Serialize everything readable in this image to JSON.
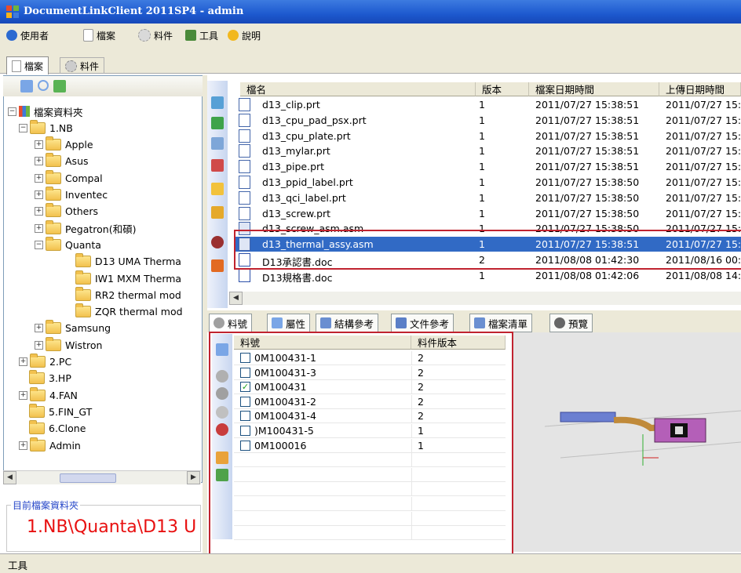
{
  "window": {
    "title": "DocumentLinkClient 2011SP4 - admin"
  },
  "menu": {
    "items": [
      {
        "label": "使用者",
        "icon": "user-icon",
        "color": "#2c6ad1"
      },
      {
        "label": "檔案",
        "icon": "file-icon",
        "color": "#f0f0f0"
      },
      {
        "label": "料件",
        "icon": "part-icon",
        "color": "#d9d9d9"
      },
      {
        "label": "工具",
        "icon": "tools-icon",
        "color": "#4a8a3a"
      },
      {
        "label": "說明",
        "icon": "help-icon",
        "color": "#f2b81e"
      }
    ]
  },
  "top_tabs": [
    {
      "label": "檔案",
      "icon": "file-icon"
    },
    {
      "label": "料件",
      "icon": "part-icon"
    }
  ],
  "tree": {
    "items": [
      {
        "label": "檔案資料夾",
        "level": 0,
        "expander": "−",
        "icon": "root-folder-icon"
      },
      {
        "label": "1.NB",
        "level": 1,
        "expander": "−",
        "icon": "folder-icon"
      },
      {
        "label": "Apple",
        "level": 2,
        "expander": "+",
        "icon": "folder-icon"
      },
      {
        "label": "Asus",
        "level": 2,
        "expander": "+",
        "icon": "folder-icon"
      },
      {
        "label": "Compal",
        "level": 2,
        "expander": "+",
        "icon": "folder-icon"
      },
      {
        "label": "Inventec",
        "level": 2,
        "expander": "+",
        "icon": "folder-icon"
      },
      {
        "label": "Others",
        "level": 2,
        "expander": "+",
        "icon": "folder-icon"
      },
      {
        "label": "Pegatron(和碩)",
        "level": 2,
        "expander": "+",
        "icon": "folder-icon"
      },
      {
        "label": "Quanta",
        "level": 2,
        "expander": "−",
        "icon": "folder-icon"
      },
      {
        "label": "D13 UMA Therma",
        "level": 3,
        "expander": "",
        "icon": "folder-icon"
      },
      {
        "label": "IW1 MXM Therma",
        "level": 3,
        "expander": "",
        "icon": "folder-icon"
      },
      {
        "label": "RR2 thermal mod",
        "level": 3,
        "expander": "",
        "icon": "folder-icon"
      },
      {
        "label": "ZQR thermal mod",
        "level": 3,
        "expander": "",
        "icon": "folder-icon"
      },
      {
        "label": "Samsung",
        "level": 2,
        "expander": "+",
        "icon": "folder-icon"
      },
      {
        "label": "Wistron",
        "level": 2,
        "expander": "+",
        "icon": "folder-icon"
      },
      {
        "label": "2.PC",
        "level": 1,
        "expander": "+",
        "icon": "folder-icon"
      },
      {
        "label": "3.HP",
        "level": 1,
        "expander": "",
        "icon": "folder-icon"
      },
      {
        "label": "4.FAN",
        "level": 1,
        "expander": "+",
        "icon": "folder-icon"
      },
      {
        "label": "5.FIN_GT",
        "level": 1,
        "expander": "",
        "icon": "folder-icon"
      },
      {
        "label": "6.Clone",
        "level": 1,
        "expander": "",
        "icon": "folder-icon"
      },
      {
        "label": "Admin",
        "level": 1,
        "expander": "+",
        "icon": "folder-icon"
      }
    ]
  },
  "current_folder": {
    "label": "目前檔案資料夾",
    "path": "1.NB\\Quanta\\D13 U"
  },
  "file_list": {
    "columns": [
      "檔名",
      "版本",
      "檔案日期時間",
      "上傳日期時間"
    ],
    "rows": [
      {
        "name": "d13_clip.prt",
        "ver": "1",
        "date": "2011/07/27 15:38:51",
        "upload": "2011/07/27 15:",
        "icon": "part-file-icon"
      },
      {
        "name": "d13_cpu_pad_psx.prt",
        "ver": "1",
        "date": "2011/07/27 15:38:51",
        "upload": "2011/07/27 15:",
        "icon": "part-file-icon"
      },
      {
        "name": "d13_cpu_plate.prt",
        "ver": "1",
        "date": "2011/07/27 15:38:51",
        "upload": "2011/07/27 15:",
        "icon": "part-file-icon"
      },
      {
        "name": "d13_mylar.prt",
        "ver": "1",
        "date": "2011/07/27 15:38:51",
        "upload": "2011/07/27 15:",
        "icon": "part-file-icon"
      },
      {
        "name": "d13_pipe.prt",
        "ver": "1",
        "date": "2011/07/27 15:38:51",
        "upload": "2011/07/27 15:",
        "icon": "part-file-icon"
      },
      {
        "name": "d13_ppid_label.prt",
        "ver": "1",
        "date": "2011/07/27 15:38:50",
        "upload": "2011/07/27 15:",
        "icon": "part-file-icon"
      },
      {
        "name": "d13_qci_label.prt",
        "ver": "1",
        "date": "2011/07/27 15:38:50",
        "upload": "2011/07/27 15:",
        "icon": "part-file-icon"
      },
      {
        "name": "d13_screw.prt",
        "ver": "1",
        "date": "2011/07/27 15:38:50",
        "upload": "2011/07/27 15:",
        "icon": "part-file-icon"
      },
      {
        "name": "d13_screw_asm.asm",
        "ver": "1",
        "date": "2011/07/27 15:38:50",
        "upload": "2011/07/27 15:",
        "icon": "asm-file-icon"
      },
      {
        "name": "d13_thermal_assy.asm",
        "ver": "1",
        "date": "2011/07/27 15:38:51",
        "upload": "2011/07/27 15:",
        "icon": "asm-file-icon",
        "selected": true
      },
      {
        "name": "D13承認書.doc",
        "ver": "2",
        "date": "2011/08/08 01:42:30",
        "upload": "2011/08/16 00:",
        "icon": "doc-file-icon"
      },
      {
        "name": "D13規格書.doc",
        "ver": "1",
        "date": "2011/08/08 01:42:06",
        "upload": "2011/08/08 14:",
        "icon": "doc-file-icon"
      }
    ]
  },
  "bottom_tabs": [
    {
      "label": "料號",
      "icon": "gear-icon"
    },
    {
      "label": "屬性",
      "icon": "properties-icon"
    },
    {
      "label": "結構參考",
      "icon": "structure-icon"
    },
    {
      "label": "文件參考",
      "icon": "document-ref-icon"
    },
    {
      "label": "檔案清單",
      "icon": "grid-icon"
    },
    {
      "label": "預覽",
      "icon": "eye-icon"
    }
  ],
  "part_table": {
    "columns": [
      "料號",
      "料件版本"
    ],
    "rows": [
      {
        "part": "0M100431-1",
        "ver": "2",
        "checked": false
      },
      {
        "part": "0M100431-3",
        "ver": "2",
        "checked": false
      },
      {
        "part": "0M100431",
        "ver": "2",
        "checked": true
      },
      {
        "part": "0M100431-2",
        "ver": "2",
        "checked": false
      },
      {
        "part": "0M100431-4",
        "ver": "2",
        "checked": false
      },
      {
        "part": ")M100431-5",
        "ver": "1",
        "checked": false
      },
      {
        "part": "0M100016",
        "ver": "1",
        "checked": false
      }
    ]
  },
  "statusbar": {
    "text": "工具"
  },
  "colors": {
    "selection": "#316ac5",
    "highlight_box": "#c0232f",
    "path_text": "#e81010"
  }
}
